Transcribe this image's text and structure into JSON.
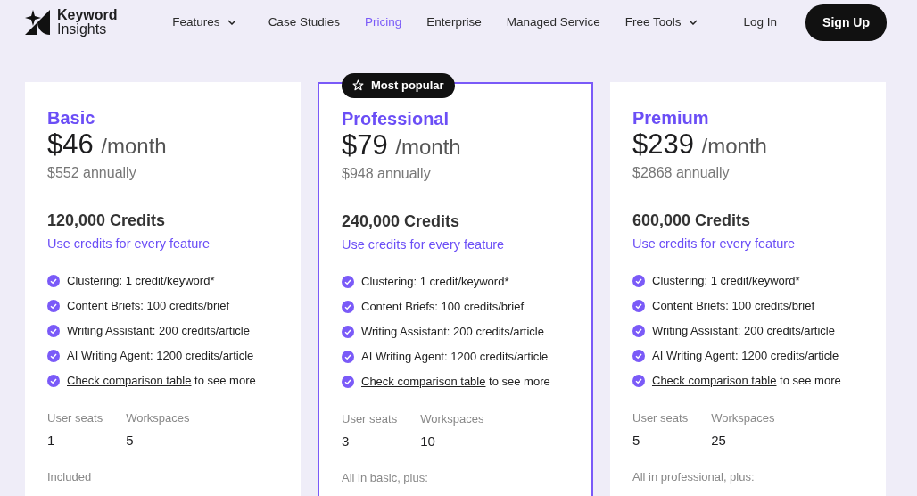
{
  "brand": {
    "name_line1": "Keyword",
    "name_line2": "Insights"
  },
  "nav": [
    {
      "label": "Features",
      "dropdown": true,
      "selected": false
    },
    {
      "label": "Case Studies",
      "dropdown": false,
      "selected": false
    },
    {
      "label": "Pricing",
      "dropdown": false,
      "selected": true
    },
    {
      "label": "Enterprise",
      "dropdown": false,
      "selected": false
    },
    {
      "label": "Managed Service",
      "dropdown": false,
      "selected": false
    },
    {
      "label": "Free Tools",
      "dropdown": true,
      "selected": false
    }
  ],
  "login": "Log In",
  "signup": "Sign Up",
  "plans": [
    {
      "name": "Basic",
      "featured": false,
      "price": "$46",
      "period": "/month",
      "annual": "$552 annually",
      "credits": "120,000 Credits",
      "credits_link": "Use credits for every feature",
      "features": [
        {
          "kind": "text",
          "text": "Clustering: 1 credit/keyword*"
        },
        {
          "kind": "text",
          "text": "Content Briefs: 100 credits/brief"
        },
        {
          "kind": "text",
          "text": "Writing Assistant: 200 credits/article"
        },
        {
          "kind": "text",
          "text": "AI Writing Agent: 1200 credits/article"
        },
        {
          "kind": "link",
          "link": "Check comparison table",
          "text": "to see more"
        }
      ],
      "stats": [
        {
          "label": "User seats",
          "value": "1"
        },
        {
          "label": "Workspaces",
          "value": "5"
        }
      ],
      "footer": "Included"
    },
    {
      "name": "Professional",
      "featured": true,
      "badge": "Most popular",
      "price": "$79",
      "period": "/month",
      "annual": "$948 annually",
      "credits": "240,000 Credits",
      "credits_link": "Use credits for every feature",
      "features": [
        {
          "kind": "text",
          "text": "Clustering: 1 credit/keyword*"
        },
        {
          "kind": "text",
          "text": "Content Briefs: 100 credits/brief"
        },
        {
          "kind": "text",
          "text": "Writing Assistant: 200 credits/article"
        },
        {
          "kind": "text",
          "text": "AI Writing Agent: 1200 credits/article"
        },
        {
          "kind": "link",
          "link": "Check comparison table",
          "text": "to see more"
        }
      ],
      "stats": [
        {
          "label": "User seats",
          "value": "3"
        },
        {
          "label": "Workspaces",
          "value": "10"
        }
      ],
      "footer": "All in basic, plus:"
    },
    {
      "name": "Premium",
      "featured": false,
      "price": "$239",
      "period": "/month",
      "annual": "$2868 annually",
      "credits": "600,000 Credits",
      "credits_link": "Use credits for every feature",
      "features": [
        {
          "kind": "text",
          "text": "Clustering: 1 credit/keyword*"
        },
        {
          "kind": "text",
          "text": "Content Briefs: 100 credits/brief"
        },
        {
          "kind": "text",
          "text": "Writing Assistant: 200 credits/article"
        },
        {
          "kind": "text",
          "text": "AI Writing Agent: 1200 credits/article"
        },
        {
          "kind": "link",
          "link": "Check comparison table",
          "text": "to see more"
        }
      ],
      "stats": [
        {
          "label": "User seats",
          "value": "5"
        },
        {
          "label": "Workspaces",
          "value": "25"
        }
      ],
      "footer": "All in professional, plus:"
    }
  ]
}
